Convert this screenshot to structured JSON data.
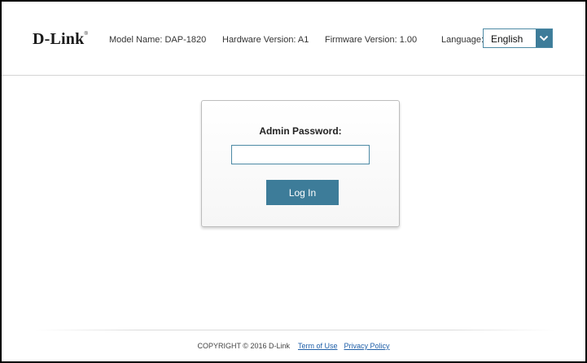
{
  "header": {
    "logo_text": "D-Link",
    "logo_mark": "®",
    "model_name": "Model Name: DAP-1820",
    "hardware_version": "Hardware Version: A1",
    "firmware_version": "Firmware Version: 1.00",
    "language_label": "Language:",
    "language_selected": "English",
    "language_icon": "chevron-down-icon"
  },
  "login": {
    "password_label": "Admin Password:",
    "password_value": "",
    "login_button": "Log In"
  },
  "footer": {
    "copyright": "COPYRIGHT © 2016 D-Link",
    "term_of_use": "Term of Use",
    "privacy_policy": "Privacy Policy"
  },
  "colors": {
    "accent": "#3d7c99",
    "input_border": "#4d8aa5",
    "link": "#1f5fa8"
  }
}
